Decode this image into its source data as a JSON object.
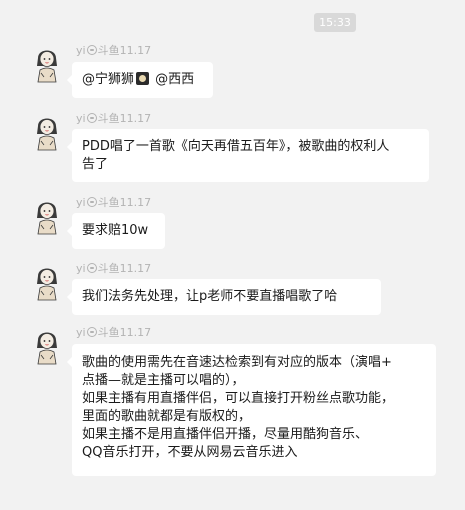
{
  "chat": {
    "timestamp": "15:33",
    "sender": {
      "name": "yi",
      "platform": "斗鱼",
      "date": "11.17",
      "platform_icon": "douyu-icon",
      "avatar_icon": "cartoon-girl-avatar"
    },
    "messages": [
      {
        "segments": [
          "@宁狮狮",
          "@西西"
        ],
        "emoji": "lion-emoji"
      },
      {
        "lines": [
          "PDD唱了一首歌《向天再借五百年》，被歌曲的权利人",
          "告了"
        ]
      },
      {
        "lines": [
          "要求赔10w"
        ]
      },
      {
        "lines": [
          "我们法务先处理，让p老师不要直播唱歌了哈"
        ]
      },
      {
        "lines": [
          "歌曲的使用需先在音速达检索到有对应的版本（演唱+",
          "点播—就是主播可以唱的），",
          "如果主播有用直播伴侣，可以直接打开粉丝点歌功能，",
          "里面的歌曲就都是有版权的，",
          "如果主播不是用直播伴侣开播，尽量用酷狗音乐、",
          "QQ音乐打开，不要从网易云音乐进入"
        ]
      }
    ]
  }
}
